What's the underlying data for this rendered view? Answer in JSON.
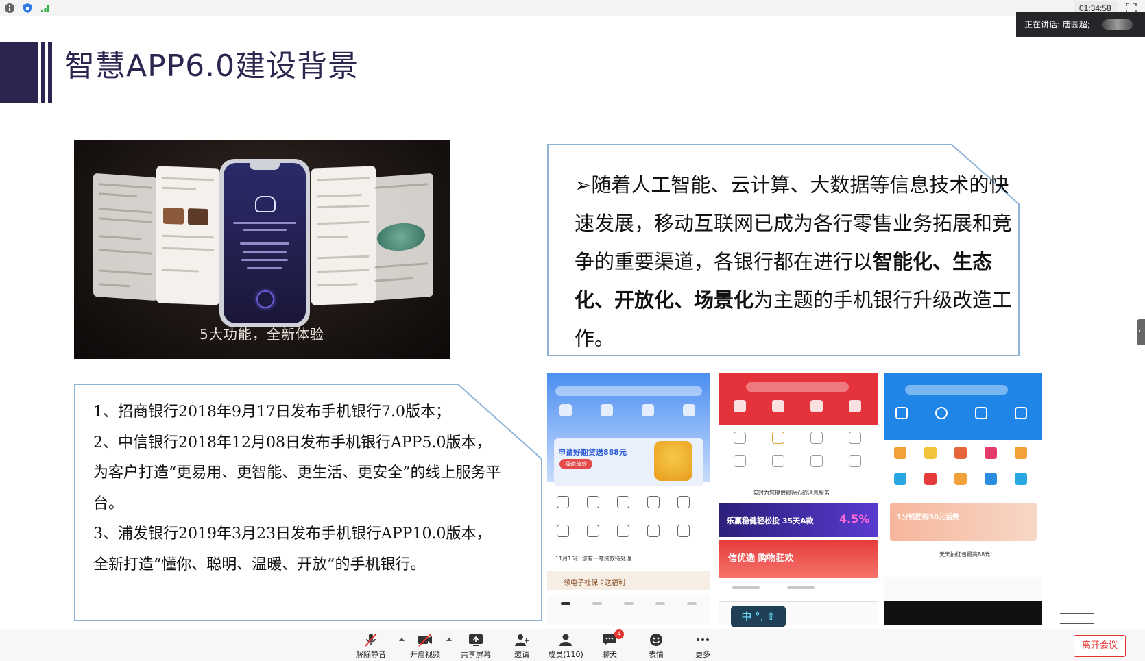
{
  "meeting": {
    "timer": "01:34:58",
    "speaking_label": "正在讲话: 唐园超;",
    "toolbar": {
      "mute": "解除静音",
      "video": "开启视频",
      "share": "共享屏幕",
      "invite": "邀请",
      "members": "成员(110)",
      "chat": "聊天",
      "chat_badge": "4",
      "reactions": "表情",
      "more": "更多",
      "leave": "离开会议"
    },
    "ime_text": "中 °, ⇧"
  },
  "slide": {
    "title": "智慧APP6.0建设背景",
    "promo_caption": "5大功能，全新体验",
    "callout": {
      "bullet": "➢",
      "part1": "随着人工智能、云计算、大数据等信息技术的快速发展，移动互联网已成为各行零售业务拓展和竞争的重要渠道，各银行都在进行以",
      "bold": "智能化、生态化、开放化、场景化",
      "part2": "为主题的手机银行升级改造工作。"
    },
    "list": [
      "1、招商银行2018年9月17日发布手机银行7.0版本；",
      "2、中信银行2018年12月08日发布手机银行APP5.0版本，为客户打造“更易用、更智能、更生活、更安全”的线上服务平台。",
      "3、浦发银行2019年3月23日发布手机银行APP10.0版本，全新打造“懂你、聪明、温暖、开放”的手机银行。"
    ],
    "screens": {
      "s1_banner": "申请好期贷送888元",
      "s1_banner_sub": "极速放款",
      "s1_notice": "11月15日,您有一笔贷款待处理",
      "s1_promo": "领电子社保卡送福利",
      "s2_banner": "乐赢稳健轻松投 35天A款",
      "s2_rate": "4.5%",
      "s2_promo": "信优选 购物狂欢",
      "s2_msg": "实时为您提供最贴心的消息服务",
      "s3_banner": "1分钱团购30元话费",
      "s3_msg": "天天抽红包最高88元!"
    }
  }
}
